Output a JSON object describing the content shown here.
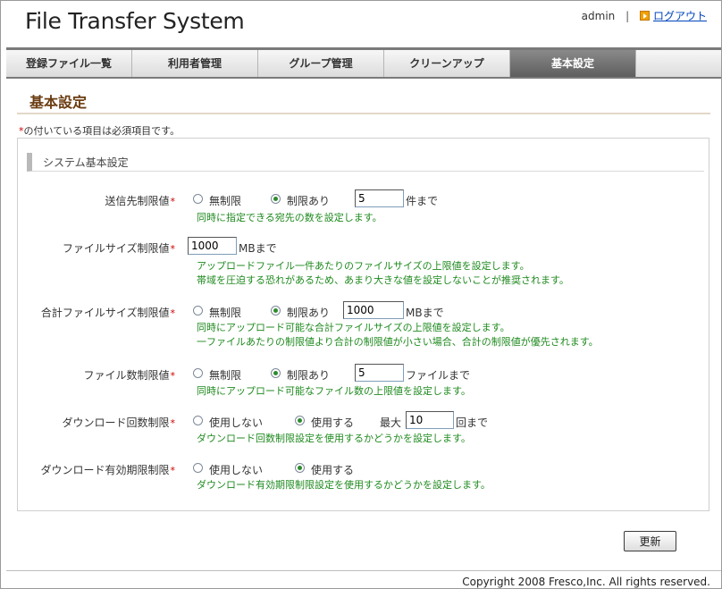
{
  "header": {
    "title": "File Transfer System",
    "user": "admin",
    "separator": "|",
    "logout": "ログアウト"
  },
  "tabs": [
    {
      "label": "登録ファイル一覧",
      "active": false
    },
    {
      "label": "利用者管理",
      "active": false
    },
    {
      "label": "グループ管理",
      "active": false
    },
    {
      "label": "クリーンアップ",
      "active": false
    },
    {
      "label": "基本設定",
      "active": true
    }
  ],
  "page": {
    "title": "基本設定",
    "required_star": "*",
    "required_note": "の付いている項目は必須項目です。"
  },
  "section": {
    "title": "システム基本設定"
  },
  "fields": {
    "recipient_limit": {
      "label": "送信先制限値",
      "star": "*",
      "opt_unlimited": "無制限",
      "opt_limited": "制限あり",
      "selected": "limited",
      "value": "5",
      "unit": "件まで",
      "help": [
        "同時に指定できる宛先の数を設定します。"
      ]
    },
    "file_size_limit": {
      "label": "ファイルサイズ制限値",
      "star": "*",
      "value": "1000",
      "unit": "MBまで",
      "help": [
        "アップロードファイル一件あたりのファイルサイズの上限値を設定します。",
        "帯域を圧迫する恐れがあるため、あまり大きな値を設定しないことが推奨されます。"
      ]
    },
    "total_size_limit": {
      "label": "合計ファイルサイズ制限値",
      "star": "*",
      "opt_unlimited": "無制限",
      "opt_limited": "制限あり",
      "selected": "limited",
      "value": "1000",
      "unit": "MBまで",
      "help": [
        "同時にアップロード可能な合計ファイルサイズの上限値を設定します。",
        "一ファイルあたりの制限値より合計の制限値が小さい場合、合計の制限値が優先されます。"
      ]
    },
    "file_count_limit": {
      "label": "ファイル数制限値",
      "star": "*",
      "opt_unlimited": "無制限",
      "opt_limited": "制限あり",
      "selected": "limited",
      "value": "5",
      "unit": "ファイルまで",
      "help": [
        "同時にアップロード可能なファイル数の上限値を設定します。"
      ]
    },
    "download_count_limit": {
      "label": "ダウンロード回数制限",
      "star": "*",
      "opt_off": "使用しない",
      "opt_on": "使用する",
      "selected": "on",
      "max_label": "最大",
      "value": "10",
      "unit": "回まで",
      "help": [
        "ダウンロード回数制限設定を使用するかどうかを設定します。"
      ]
    },
    "download_expiry_limit": {
      "label": "ダウンロード有効期限制限",
      "star": "*",
      "opt_off": "使用しない",
      "opt_on": "使用する",
      "selected": "on",
      "help": [
        "ダウンロード有効期限制限設定を使用するかどうかを設定します。"
      ]
    }
  },
  "actions": {
    "update": "更新"
  },
  "footer": {
    "copyright": "Copyright 2008 Fresco,Inc. All rights reserved."
  },
  "colors": {
    "title_brown": "#6b3d12",
    "help_green": "#1f8a1f",
    "required_red": "#cc0000",
    "active_tab": "#6e6e6e",
    "link_blue": "#0044bb"
  }
}
